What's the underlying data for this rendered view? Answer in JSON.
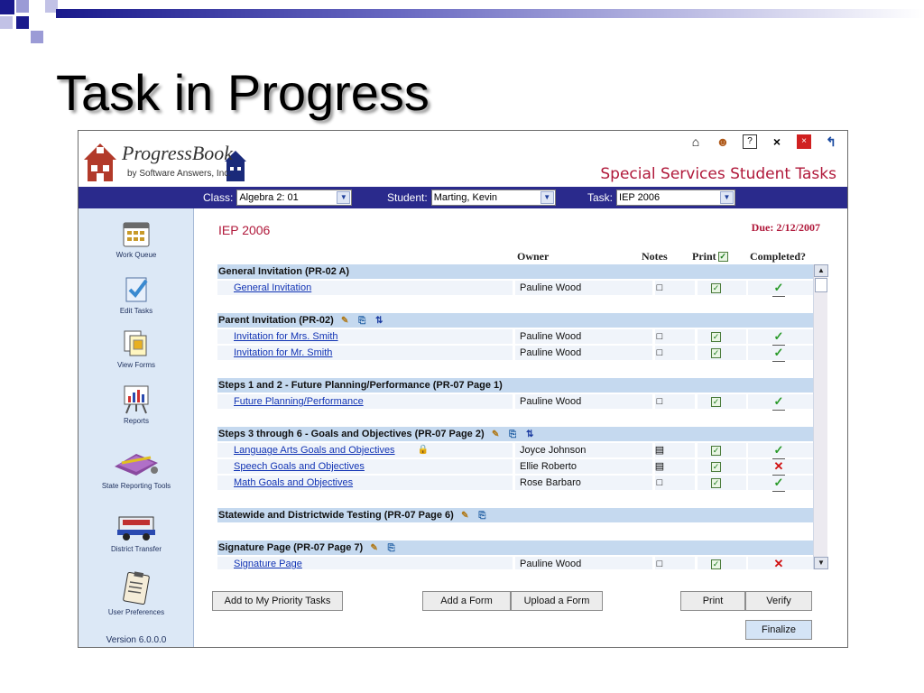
{
  "slide": {
    "title": "Task in Progress"
  },
  "header": {
    "logo_name": "ProgressBook",
    "logo_sub": "by Software Answers, Inc.",
    "page_heading": "Special Services Student Tasks",
    "icons": [
      "home-icon",
      "help-person-icon",
      "help-icon",
      "close-x-icon",
      "close-red-icon",
      "back-arrow-icon"
    ]
  },
  "filters": {
    "class_label": "Class:",
    "class_value": "Algebra 2: 01",
    "student_label": "Student:",
    "student_value": "Marting, Kevin",
    "task_label": "Task:",
    "task_value": "IEP 2006"
  },
  "sidebar": {
    "items": [
      {
        "label": "Work Queue",
        "icon": "calendar-icon"
      },
      {
        "label": "Edit Tasks",
        "icon": "checkmark-doc-icon"
      },
      {
        "label": "View Forms",
        "icon": "forms-icon"
      },
      {
        "label": "Reports",
        "icon": "chart-easel-icon"
      },
      {
        "label": "State Reporting Tools",
        "icon": "toolbox-icon"
      },
      {
        "label": "District Transfer",
        "icon": "bus-icon"
      },
      {
        "label": "User Preferences",
        "icon": "clipboard-icon"
      }
    ],
    "version": "Version 6.0.0.0"
  },
  "main": {
    "task_title": "IEP 2006",
    "due": "Due:  2/12/2007",
    "columns": {
      "owner": "Owner",
      "notes": "Notes",
      "print": "Print",
      "completed": "Completed?"
    },
    "sections": [
      {
        "title": "General Invitation  (PR-02 A)",
        "icons": [],
        "items": [
          {
            "name": "General Invitation",
            "owner": "Pauline Wood",
            "notes": "empty",
            "print": true,
            "completed": "yes",
            "locked": false
          }
        ]
      },
      {
        "title": "Parent Invitation  (PR-02)",
        "icons": [
          "edit-icon",
          "copy-icon",
          "sort-icon"
        ],
        "items": [
          {
            "name": "Invitation for Mrs. Smith",
            "owner": "Pauline Wood",
            "notes": "empty",
            "print": true,
            "completed": "yes",
            "locked": false
          },
          {
            "name": "Invitation for Mr. Smith",
            "owner": "Pauline Wood",
            "notes": "empty",
            "print": true,
            "completed": "yes",
            "locked": false
          }
        ]
      },
      {
        "title": "Steps 1 and 2 - Future Planning/Performance  (PR-07 Page 1)",
        "icons": [],
        "items": [
          {
            "name": "Future Planning/Performance",
            "owner": "Pauline Wood",
            "notes": "empty",
            "print": true,
            "completed": "yes",
            "locked": false
          }
        ]
      },
      {
        "title": "Steps 3 through 6 - Goals and Objectives  (PR-07 Page 2)",
        "icons": [
          "edit-icon",
          "copy-icon",
          "sort-icon"
        ],
        "items": [
          {
            "name": "Language Arts Goals and Objectives",
            "owner": "Joyce Johnson",
            "notes": "has-note",
            "print": true,
            "completed": "yes",
            "locked": true
          },
          {
            "name": "Speech Goals and Objectives",
            "owner": "Ellie Roberto",
            "notes": "has-note",
            "print": true,
            "completed": "no",
            "locked": false
          },
          {
            "name": "Math Goals and Objectives",
            "owner": "Rose Barbaro",
            "notes": "empty",
            "print": true,
            "completed": "yes",
            "locked": false
          }
        ]
      },
      {
        "title": "Statewide and Districtwide Testing  (PR-07 Page 6)",
        "icons": [
          "edit-icon",
          "copy-icon"
        ],
        "items": []
      },
      {
        "title": "Signature Page  (PR-07 Page 7)",
        "icons": [
          "edit-icon",
          "copy-icon"
        ],
        "items": [
          {
            "name": "Signature Page",
            "owner": "Pauline Wood",
            "notes": "empty",
            "print": true,
            "completed": "no",
            "locked": false
          }
        ]
      }
    ]
  },
  "buttons": {
    "add_priority": "Add to My Priority Tasks",
    "add_form": "Add a Form",
    "upload_form": "Upload a Form",
    "print": "Print",
    "verify": "Verify",
    "finalize": "Finalize"
  },
  "colors": {
    "filter_bar": "#2a2a8c",
    "section_row": "#c5d9ef",
    "sidebar": "#dce8f6",
    "accent_red": "#b0183a",
    "link": "#1234b4"
  }
}
